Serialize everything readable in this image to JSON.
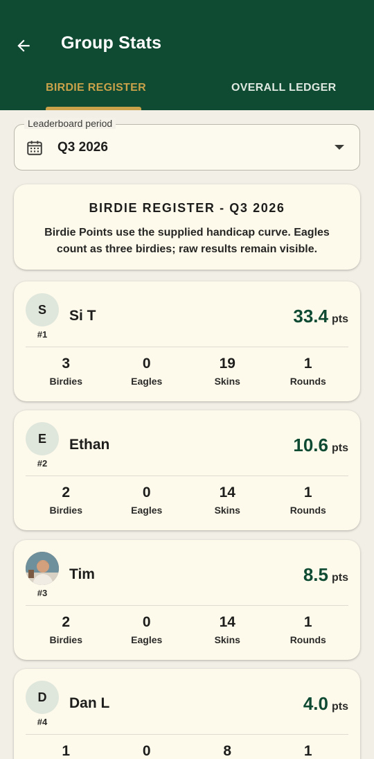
{
  "header": {
    "title": "Group Stats",
    "back_icon": "arrow-left-icon"
  },
  "tabs": [
    {
      "label": "BIRDIE REGISTER",
      "active": true
    },
    {
      "label": "OVERALL LEDGER",
      "active": false
    }
  ],
  "period": {
    "label": "Leaderboard period",
    "value": "Q3 2026",
    "icon": "calendar-icon"
  },
  "info": {
    "title": "BIRDIE REGISTER - Q3 2026",
    "body": "Birdie Points use the supplied handicap curve. Eagles count as three birdies; raw results remain visible."
  },
  "stat_labels": {
    "birdies": "Birdies",
    "eagles": "Eagles",
    "skins": "Skins",
    "rounds": "Rounds"
  },
  "players": [
    {
      "initial": "S",
      "rank": "#1",
      "name": "Si T",
      "points": "33.4",
      "unit": "pts",
      "birdies": "3",
      "eagles": "0",
      "skins": "19",
      "rounds": "1"
    },
    {
      "initial": "E",
      "rank": "#2",
      "name": "Ethan",
      "points": "10.6",
      "unit": "pts",
      "birdies": "2",
      "eagles": "0",
      "skins": "14",
      "rounds": "1"
    },
    {
      "initial": "",
      "rank": "#3",
      "name": "Tim",
      "points": "8.5",
      "unit": "pts",
      "birdies": "2",
      "eagles": "0",
      "skins": "14",
      "rounds": "1",
      "photo": true
    },
    {
      "initial": "D",
      "rank": "#4",
      "name": "Dan L",
      "points": "4.0",
      "unit": "pts",
      "birdies": "1",
      "eagles": "0",
      "skins": "8",
      "rounds": "1"
    }
  ],
  "colors": {
    "header_bg": "#0f4a33",
    "tab_active": "#c9a24a",
    "points": "#0f4a33",
    "card_bg": "#fdf9eb",
    "page_bg": "#f2efe6"
  }
}
